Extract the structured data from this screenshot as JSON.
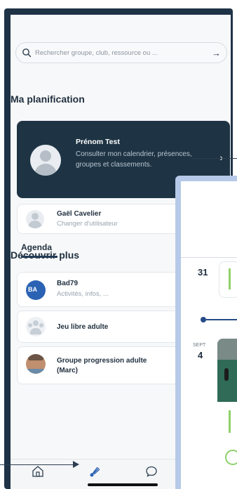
{
  "search": {
    "placeholder": "Rechercher groupe, club, ressource ou ..."
  },
  "planning": {
    "title": "Ma planification",
    "profile": {
      "name": "Prénom Test",
      "description": "Consulter mon calendrier, présences, groupes et classements."
    },
    "switch_user": {
      "name": "Gaël Cavelier",
      "subtitle": "Changer d'utilisateur"
    }
  },
  "discover": {
    "title": "Découvrir plus",
    "items": [
      {
        "title": "Bad79",
        "subtitle": "Activités, infos, ..."
      },
      {
        "title": "Jeu libre adulte"
      },
      {
        "title": "Groupe progression adulte (Marc)"
      }
    ]
  },
  "tabbar": {
    "items": [
      {
        "icon": "home-icon"
      },
      {
        "icon": "badminton-shuttle-icon"
      },
      {
        "icon": "chat-icon"
      }
    ]
  },
  "agenda_screen": {
    "tab_label": "Agenda",
    "day_1": "31",
    "month_2": "SEPT",
    "day_2": "4"
  },
  "colors": {
    "primary_dark": "#1e3444",
    "accent_green": "#8ed16a",
    "timeline_blue": "#264b87"
  }
}
